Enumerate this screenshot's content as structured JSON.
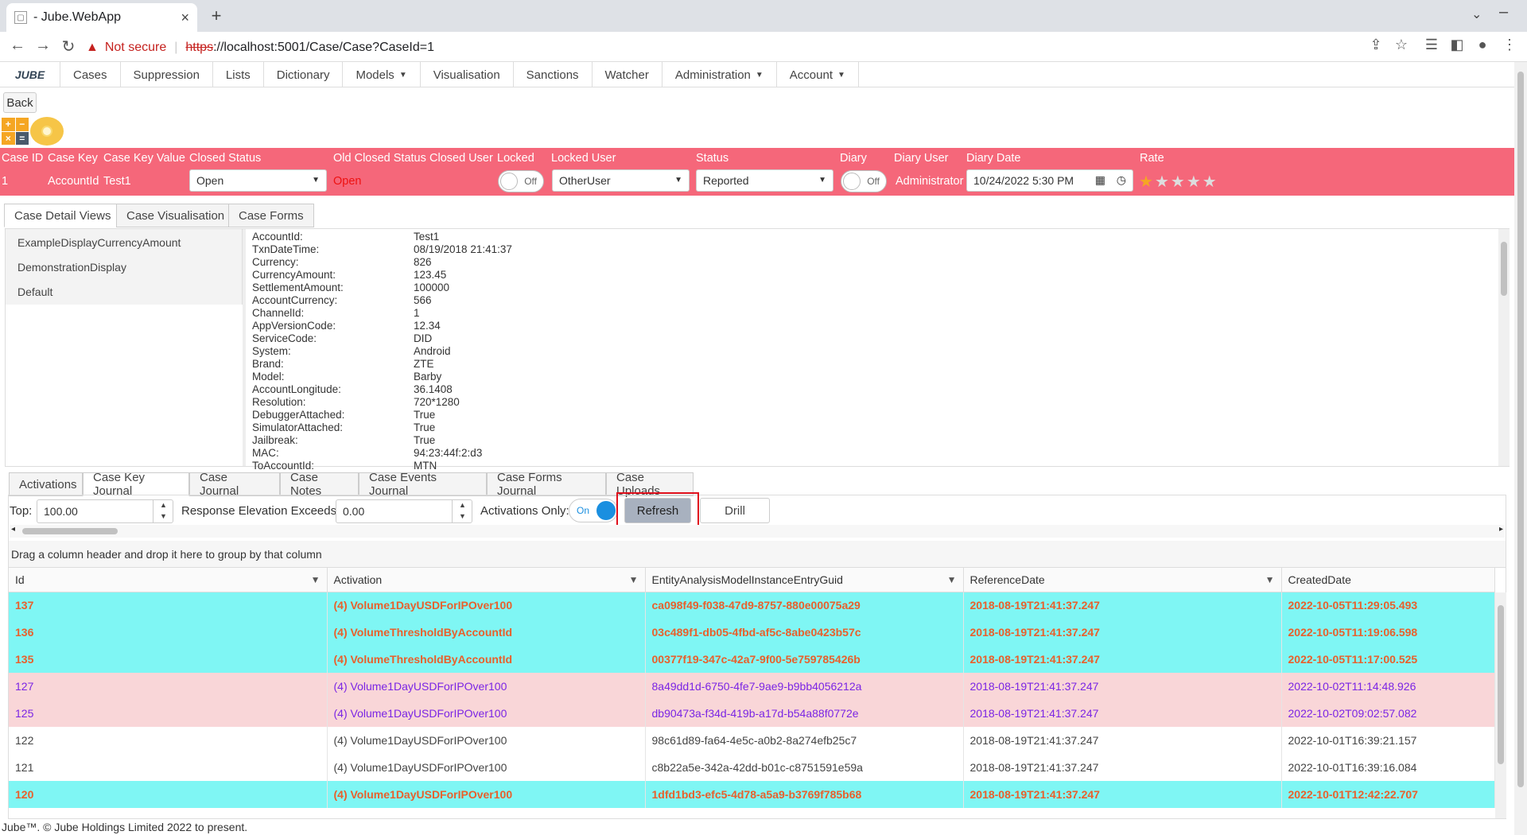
{
  "browser": {
    "tab_title": "- Jube.WebApp",
    "not_secure": "Not secure",
    "url_scheme": "https",
    "url_rest": "://localhost:5001/Case/Case?CaseId=1"
  },
  "menu": {
    "logo_text": "JUBE",
    "items": [
      "Cases",
      "Suppression",
      "Lists",
      "Dictionary",
      "Models",
      "Visualisation",
      "Sanctions",
      "Watcher",
      "Administration",
      "Account"
    ]
  },
  "back_label": "Back",
  "calc": [
    "+",
    "−",
    "×",
    "="
  ],
  "case_header": {
    "labels": {
      "case_id": "Case ID",
      "case_key": "Case Key",
      "case_key_value": "Case Key Value",
      "closed_status": "Closed Status",
      "old_closed_status": "Old Closed Status",
      "closed_user": "Closed User",
      "locked": "Locked",
      "locked_user": "Locked User",
      "status": "Status",
      "diary": "Diary",
      "diary_user": "Diary User",
      "diary_date": "Diary Date",
      "rate": "Rate"
    },
    "values": {
      "case_id": "1",
      "case_key": "AccountId",
      "case_key_value": "Test1",
      "closed_status": "Open",
      "old_closed_status": "Open",
      "locked_toggle": "Off",
      "locked_user": "OtherUser",
      "status": "Reported",
      "diary_toggle": "Off",
      "diary_user": "Administrator",
      "diary_date": "10/24/2022 5:30 PM",
      "rate_stars": 1,
      "rate_max": 5
    }
  },
  "main_tabs": [
    "Case Detail Views",
    "Case Visualisation",
    "Case Forms"
  ],
  "detail_views": [
    "ExampleDisplayCurrencyAmount",
    "DemonstrationDisplay",
    "Default"
  ],
  "fields": [
    {
      "k": "AccountId:",
      "v": "Test1"
    },
    {
      "k": "TxnDateTime:",
      "v": "08/19/2018 21:41:37"
    },
    {
      "k": "Currency:",
      "v": "826"
    },
    {
      "k": "CurrencyAmount:",
      "v": "123.45"
    },
    {
      "k": "SettlementAmount:",
      "v": "100000"
    },
    {
      "k": "AccountCurrency:",
      "v": "566"
    },
    {
      "k": "ChannelId:",
      "v": "1"
    },
    {
      "k": "AppVersionCode:",
      "v": "12.34"
    },
    {
      "k": "ServiceCode:",
      "v": "DID"
    },
    {
      "k": "System:",
      "v": "Android"
    },
    {
      "k": "Brand:",
      "v": "ZTE"
    },
    {
      "k": "Model:",
      "v": "Barby"
    },
    {
      "k": "AccountLongitude:",
      "v": "36.1408"
    },
    {
      "k": "Resolution:",
      "v": "720*1280"
    },
    {
      "k": "DebuggerAttached:",
      "v": "True"
    },
    {
      "k": "SimulatorAttached:",
      "v": "True"
    },
    {
      "k": "Jailbreak:",
      "v": "True"
    },
    {
      "k": "MAC:",
      "v": "94:23:44f:2:d3"
    },
    {
      "k": "ToAccountId:",
      "v": "MTN"
    }
  ],
  "journal_tabs": [
    "Activations",
    "Case Key Journal",
    "Case Journal",
    "Case Notes",
    "Case Events Journal",
    "Case Forms Journal",
    "Case Uploads"
  ],
  "toolbar": {
    "top_label": "Top:",
    "top_value": "100.00",
    "elev_label": "Response Elevation Exceeds:",
    "elev_value": "0.00",
    "activations_label": "Activations Only:",
    "activations_toggle": "On",
    "refresh": "Refresh",
    "drill": "Drill"
  },
  "group_hint": "Drag a column header and drop it here to group by that column",
  "grid": {
    "columns": [
      "Id",
      "Activation",
      "EntityAnalysisModelInstanceEntryGuid",
      "ReferenceDate",
      "CreatedDate"
    ],
    "rows": [
      {
        "style": "cyan",
        "cells": [
          "137",
          "(4) Volume1DayUSDForIPOver100",
          "ca098f49-f038-47d9-8757-880e00075a29",
          "2018-08-19T21:41:37.247",
          "2022-10-05T11:29:05.493"
        ]
      },
      {
        "style": "cyan",
        "cells": [
          "136",
          "(4) VolumeThresholdByAccountId",
          "03c489f1-db05-4fbd-af5c-8abe0423b57c",
          "2018-08-19T21:41:37.247",
          "2022-10-05T11:19:06.598"
        ]
      },
      {
        "style": "cyan",
        "cells": [
          "135",
          "(4) VolumeThresholdByAccountId",
          "00377f19-347c-42a7-9f00-5e759785426b",
          "2018-08-19T21:41:37.247",
          "2022-10-05T11:17:00.525"
        ]
      },
      {
        "style": "pink",
        "cells": [
          "127",
          "(4) Volume1DayUSDForIPOver100",
          "8a49dd1d-6750-4fe7-9ae9-b9bb4056212a",
          "2018-08-19T21:41:37.247",
          "2022-10-02T11:14:48.926"
        ]
      },
      {
        "style": "pink",
        "cells": [
          "125",
          "(4) Volume1DayUSDForIPOver100",
          "db90473a-f34d-419b-a17d-b54a88f0772e",
          "2018-08-19T21:41:37.247",
          "2022-10-02T09:02:57.082"
        ]
      },
      {
        "style": "plain",
        "cells": [
          "122",
          "(4) Volume1DayUSDForIPOver100",
          "98c61d89-fa64-4e5c-a0b2-8a274efb25c7",
          "2018-08-19T21:41:37.247",
          "2022-10-01T16:39:21.157"
        ]
      },
      {
        "style": "plain",
        "cells": [
          "121",
          "(4) Volume1DayUSDForIPOver100",
          "c8b22a5e-342a-42dd-b01c-c8751591e59a",
          "2018-08-19T21:41:37.247",
          "2022-10-01T16:39:16.084"
        ]
      },
      {
        "style": "cyan",
        "cells": [
          "120",
          "(4) Volume1DayUSDForIPOver100",
          "1dfd1bd3-efc5-4d78-a5a9-b3769f785b68",
          "2018-08-19T21:41:37.247",
          "2022-10-01T12:42:22.707"
        ]
      }
    ]
  },
  "footer": "Jube™. © Jube Holdings Limited 2022 to present.",
  "colors": {
    "case_header": "#f5677a",
    "activation_row": "#7ff6f4",
    "elevated_row": "#f9d6d8",
    "highlight": "#e0101c"
  }
}
